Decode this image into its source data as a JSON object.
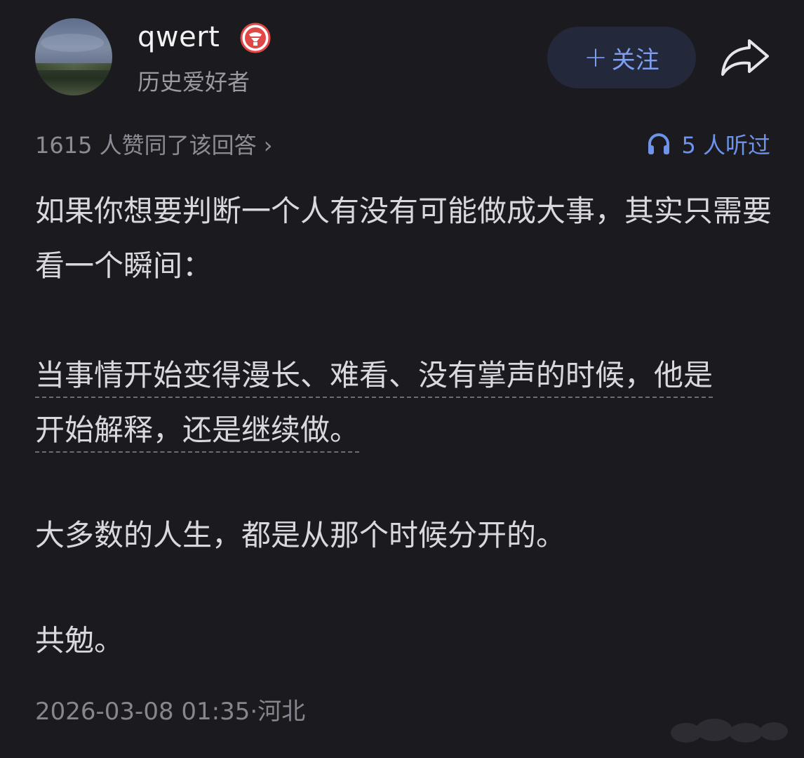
{
  "author": {
    "name": "qwert",
    "bio": "历史爱好者"
  },
  "actions": {
    "follow_plus": "+",
    "follow_label": "关注"
  },
  "stats": {
    "upvotes": "1615 人赞同了该回答 ›",
    "listened": "5 人听过"
  },
  "answer": {
    "p1": "如果你想要判断一个人有没有可能做成大事，其实只需要看一个瞬间：",
    "p2": "当事情开始变得漫长、难看、没有掌声的时候，他是开始解释，还是继续做。",
    "p3": "大多数的人生，都是从那个时候分开的。",
    "p4": "共勉。"
  },
  "footer": {
    "datetime": "2026-03-08 01:35",
    "separator": "·",
    "location": "河北"
  },
  "colors": {
    "background": "#1b1b1f",
    "accent_blue": "#7e9ff0",
    "badge_red": "#e04848"
  },
  "icons": {
    "badge": "red-badge-icon",
    "share": "share-arrow-icon",
    "headphones": "headphones-icon"
  }
}
